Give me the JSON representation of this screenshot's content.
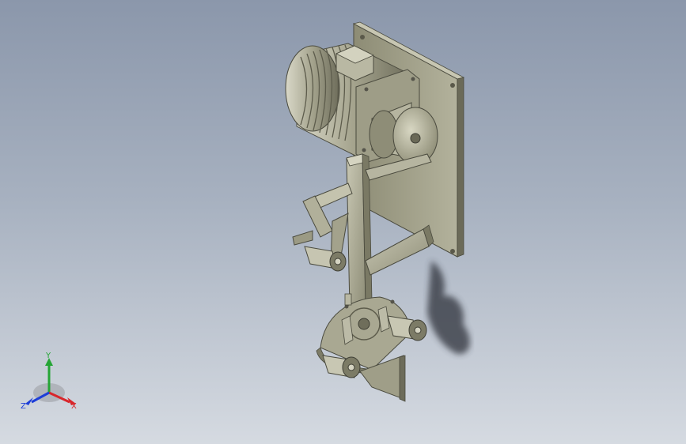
{
  "viewport": {
    "background_top": "#8b97ab",
    "background_bottom": "#d5dae1"
  },
  "model": {
    "metal_color": "#a9a892",
    "shadow_color": "#2f323a",
    "components": [
      "motor",
      "mounting-plate",
      "pulley",
      "frame-column",
      "lever-arm",
      "idler-roller",
      "contact-wheel-plate",
      "belt-guide-plate"
    ]
  },
  "triad": {
    "x_label": "X",
    "y_label": "Y",
    "z_label": "Z",
    "x_color": "#d8262b",
    "y_color": "#25a535",
    "z_color": "#1d3ed8"
  }
}
